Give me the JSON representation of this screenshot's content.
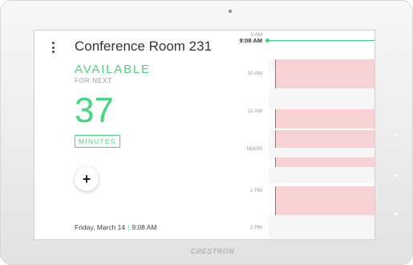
{
  "device": {
    "brand": "CRESTRON",
    "side_buttons": [
      "power-icon",
      "home-icon",
      "lightbulb-icon",
      "volume-up-icon",
      "volume-down-icon"
    ]
  },
  "room": {
    "title": "Conference Room 231",
    "status": "AVAILABLE",
    "for_next": "FOR NEXT",
    "minutes_value": "37",
    "minutes_label": "MINUTES",
    "add_label": "+"
  },
  "footer": {
    "date": "Friday, March 14",
    "time": "9:08 AM"
  },
  "timeline": {
    "current_time": "9:08 AM",
    "hour_labels": [
      "9 AM",
      "10 AM",
      "11 AM",
      "NOON",
      "1 PM",
      "2 PM"
    ],
    "accent_color": "#44d67d",
    "meeting_color": "#f7d2d4"
  }
}
